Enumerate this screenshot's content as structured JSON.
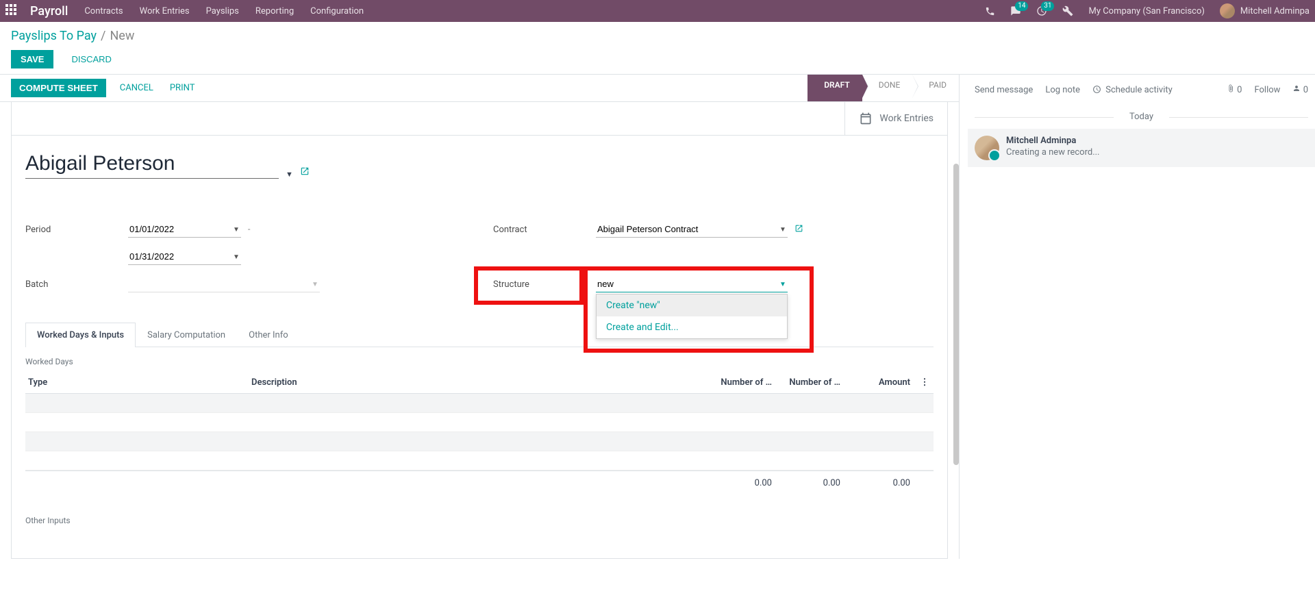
{
  "navbar": {
    "brand": "Payroll",
    "items": [
      "Contracts",
      "Work Entries",
      "Payslips",
      "Reporting",
      "Configuration"
    ],
    "msg_count": "14",
    "activity_count": "31",
    "company": "My Company (San Francisco)",
    "user": "Mitchell Adminpa"
  },
  "breadcrumb": {
    "parent": "Payslips To Pay",
    "sep": "/",
    "current": "New"
  },
  "cp": {
    "save": "SAVE",
    "discard": "DISCARD"
  },
  "statusbar": {
    "compute": "COMPUTE SHEET",
    "cancel": "CANCEL",
    "print": "PRINT",
    "stages": [
      "DRAFT",
      "DONE",
      "PAID"
    ]
  },
  "button_box": {
    "work_entries": "Work Entries"
  },
  "form": {
    "employee": "Abigail Peterson",
    "labels": {
      "period": "Period",
      "batch": "Batch",
      "contract": "Contract",
      "structure": "Structure"
    },
    "period_from": "01/01/2022",
    "period_to": "01/31/2022",
    "period_sep": "-",
    "batch": "",
    "contract": "Abigail Peterson Contract",
    "structure_input": "new",
    "dd_create": "Create \"new\"",
    "dd_create_edit": "Create and Edit..."
  },
  "tabs": {
    "t1": "Worked Days & Inputs",
    "t2": "Salary Computation",
    "t3": "Other Info"
  },
  "worked": {
    "section": "Worked Days",
    "cols": {
      "type": "Type",
      "desc": "Description",
      "days": "Number of …",
      "hours": "Number of …",
      "amount": "Amount"
    },
    "foot": {
      "days": "0.00",
      "hours": "0.00",
      "amount": "0.00"
    },
    "other_section": "Other Inputs"
  },
  "chatter": {
    "send": "Send message",
    "log": "Log note",
    "schedule": "Schedule activity",
    "attach_count": "0",
    "follow": "Follow",
    "follower_count": "0",
    "today": "Today",
    "msg_author": "Mitchell Adminpa",
    "msg_text": "Creating a new record..."
  }
}
